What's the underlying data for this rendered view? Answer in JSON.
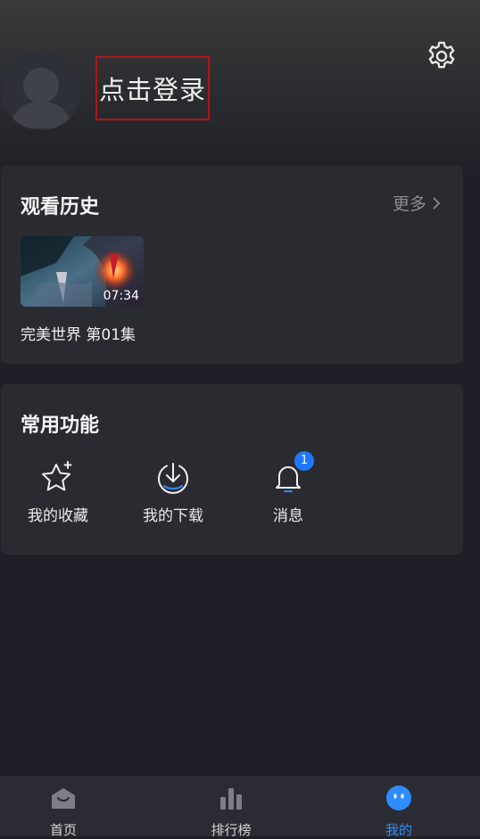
{
  "header": {
    "login_label": "点击登录"
  },
  "history": {
    "title": "观看历史",
    "more_label": "更多",
    "items": [
      {
        "title": "完美世界 第01集",
        "duration": "07:34"
      }
    ]
  },
  "functions": {
    "title": "常用功能",
    "items": [
      {
        "label": "我的收藏",
        "icon": "star-icon"
      },
      {
        "label": "我的下载",
        "icon": "download-icon"
      },
      {
        "label": "消息",
        "icon": "bell-icon",
        "badge": "1"
      }
    ]
  },
  "tabbar": {
    "items": [
      {
        "label": "首页",
        "icon": "home-icon",
        "active": false
      },
      {
        "label": "排行榜",
        "icon": "ranking-icon",
        "active": false
      },
      {
        "label": "我的",
        "icon": "profile-icon",
        "active": true
      }
    ]
  },
  "colors": {
    "background": "#1f2027",
    "card": "#2a2b31",
    "accent": "#2f8cff",
    "login_border": "#b31414"
  }
}
